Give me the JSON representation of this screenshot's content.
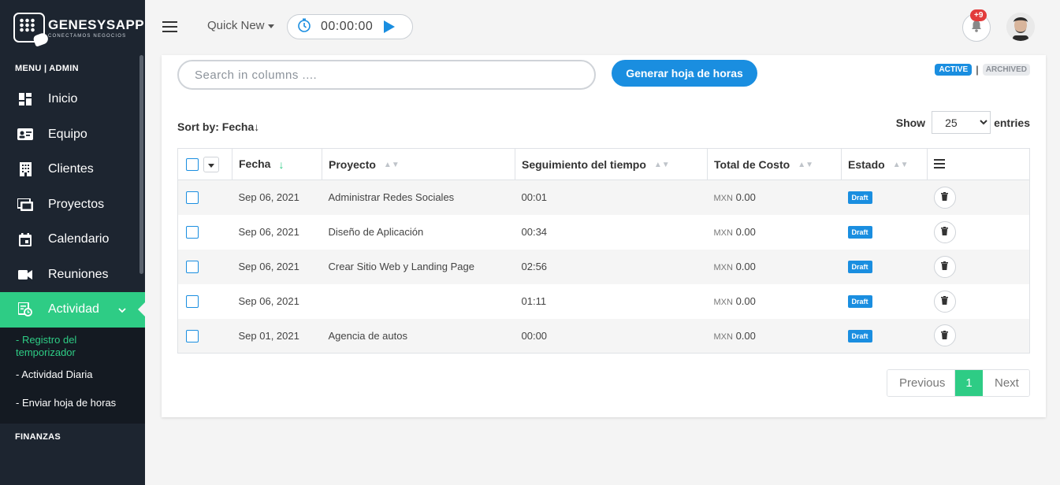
{
  "app": {
    "name": "GENESYSAPP",
    "tagline": "CONECTAMOS NEGOCIOS"
  },
  "sidebar": {
    "section_admin": "MENU | ADMIN",
    "items": [
      {
        "label": "Inicio",
        "icon": "dashboard-icon"
      },
      {
        "label": "Equipo",
        "icon": "id-card-icon"
      },
      {
        "label": "Clientes",
        "icon": "building-icon"
      },
      {
        "label": "Proyectos",
        "icon": "folders-icon"
      },
      {
        "label": "Calendario",
        "icon": "calendar-icon"
      },
      {
        "label": "Reuniones",
        "icon": "video-camera-icon"
      },
      {
        "label": "Actividad",
        "icon": "activity-clock-icon",
        "active": true
      }
    ],
    "submenu": [
      {
        "label": "- Registro del temporizador",
        "current": true
      },
      {
        "label": "- Actividad Diaria"
      },
      {
        "label": "- Enviar hoja de horas"
      }
    ],
    "section_finanzas": "FINANZAS"
  },
  "topbar": {
    "quick_new": "Quick New",
    "timer_value": "00:00:00",
    "notification_count": "+9"
  },
  "toolbar": {
    "search_placeholder": "Search in columns ....",
    "generate_label": "Generar hoja de horas",
    "status_active": "ACTIVE",
    "status_separator": "|",
    "status_archived": "ARCHIVED",
    "sort_by": "Sort by: Fecha↓",
    "show_label": "Show",
    "entries_value": "25",
    "entries_label": "entries"
  },
  "table": {
    "columns": [
      "Fecha",
      "Proyecto",
      "Seguimiento del tiempo",
      "Total de Costo",
      "Estado"
    ],
    "rows": [
      {
        "fecha": "Sep 06, 2021",
        "proyecto": "Administrar Redes Sociales",
        "tiempo": "00:01",
        "moneda": "MXN",
        "costo": "0.00",
        "estado": "Draft"
      },
      {
        "fecha": "Sep 06, 2021",
        "proyecto": "Diseño de Aplicación",
        "tiempo": "00:34",
        "moneda": "MXN",
        "costo": "0.00",
        "estado": "Draft"
      },
      {
        "fecha": "Sep 06, 2021",
        "proyecto": "Crear Sitio Web y Landing Page",
        "tiempo": "02:56",
        "moneda": "MXN",
        "costo": "0.00",
        "estado": "Draft"
      },
      {
        "fecha": "Sep 06, 2021",
        "proyecto": "",
        "tiempo": "01:11",
        "moneda": "MXN",
        "costo": "0.00",
        "estado": "Draft"
      },
      {
        "fecha": "Sep 01, 2021",
        "proyecto": "Agencia de autos",
        "tiempo": "00:00",
        "moneda": "MXN",
        "costo": "0.00",
        "estado": "Draft"
      }
    ]
  },
  "pagination": {
    "previous": "Previous",
    "current": "1",
    "next": "Next"
  },
  "colors": {
    "sidebar_bg": "#1d2530",
    "accent_green": "#2ecc85",
    "primary_blue": "#1a8ee0",
    "badge_red": "#e23b3b"
  }
}
